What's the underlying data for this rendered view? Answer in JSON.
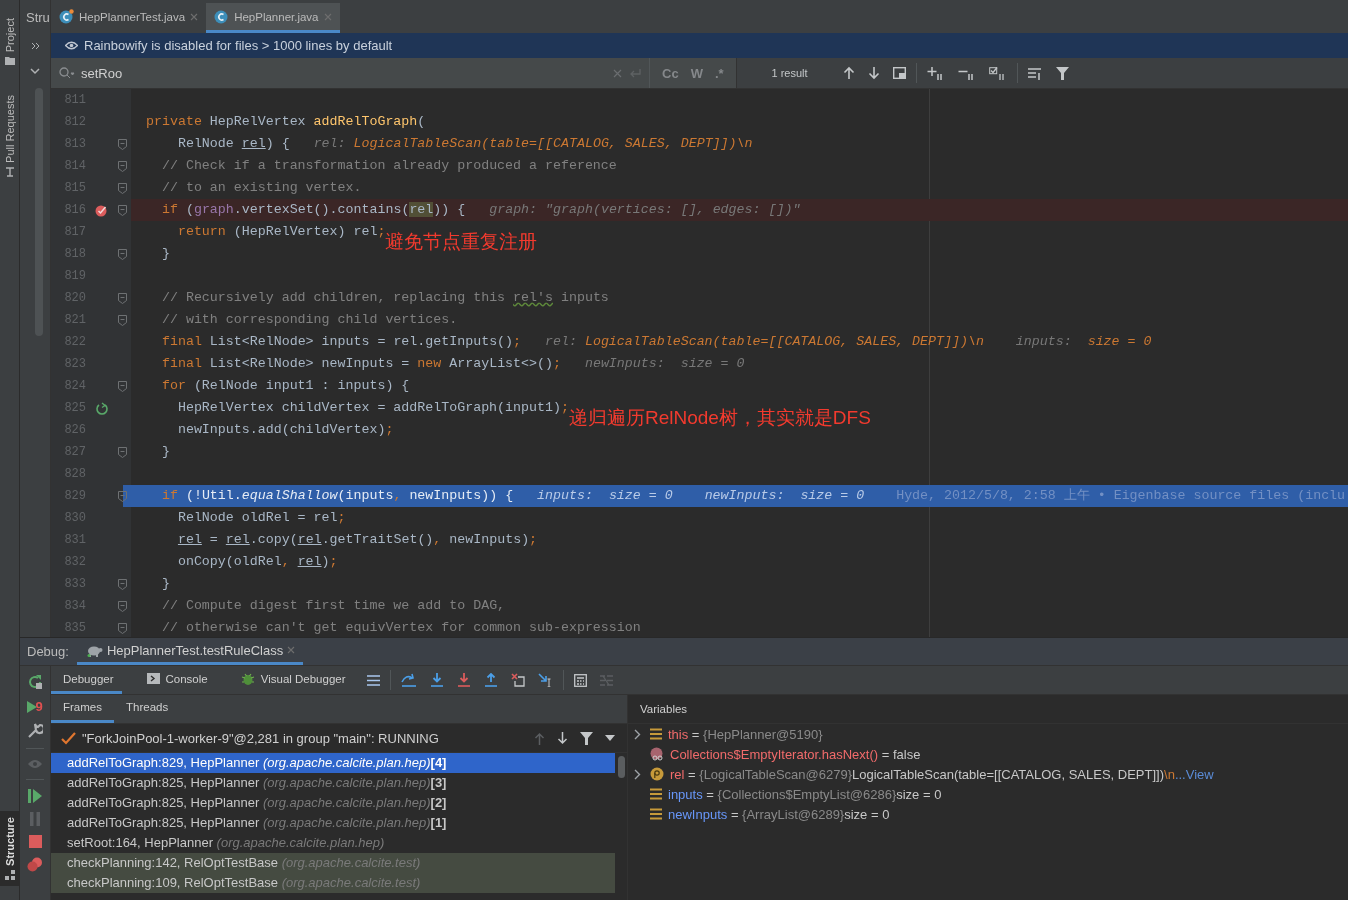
{
  "tool_strip": [
    {
      "label": "Project",
      "selected": false
    },
    {
      "label": "Pull Requests",
      "selected": false
    },
    {
      "label": "Structure",
      "selected": true
    }
  ],
  "structure_panel": {
    "title": "Stru"
  },
  "tabs": [
    {
      "label": "HepPlannerTest.java",
      "selected": false,
      "kind": "test"
    },
    {
      "label": "HepPlanner.java",
      "selected": true,
      "kind": "class"
    }
  ],
  "banner": {
    "text": "Rainbowify is disabled for files > 1000 lines by default"
  },
  "search": {
    "value": "setRoo",
    "toggles": [
      {
        "label": "Cc",
        "enabled": false
      },
      {
        "label": "W",
        "enabled": false
      },
      {
        "label": ".*",
        "enabled": false
      }
    ],
    "result": "1 result"
  },
  "editor": {
    "lines": [
      {
        "number": "811",
        "current": false
      },
      {
        "number": "812",
        "current": false,
        "segments": [
          {
            "kind": "kw",
            "text": "private "
          },
          {
            "kind": "id",
            "text": "HepRelVertex "
          },
          {
            "kind": "fn",
            "text": "addRelToGraph"
          },
          {
            "kind": "id",
            "text": "("
          }
        ]
      },
      {
        "number": "813",
        "current": false,
        "fold": true,
        "segments": [
          {
            "kind": "id",
            "text": "    RelNode "
          },
          {
            "kind": "u",
            "text": "rel"
          },
          {
            "kind": "id",
            "text": ") {"
          },
          {
            "kind": "hl",
            "text": "   rel: "
          },
          {
            "kind": "hv",
            "text": "LogicalTableScan(table=[[CATALOG, SALES, DEPT]])\\n"
          }
        ]
      },
      {
        "number": "814",
        "current": false,
        "fold": true,
        "segments": [
          {
            "kind": "cm",
            "text": "  // Check if a transformation already produced a reference"
          }
        ]
      },
      {
        "number": "815",
        "current": false,
        "fold": true,
        "segments": [
          {
            "kind": "cm",
            "text": "  // to an existing vertex."
          }
        ]
      },
      {
        "number": "816",
        "current": false,
        "marker": {
          "kind": "breakpoint"
        },
        "fold": true,
        "segments": [
          {
            "kind": "kw",
            "text": "  if "
          },
          {
            "kind": "id",
            "text": "("
          },
          {
            "kind": "field",
            "text": "graph"
          },
          {
            "kind": "id",
            "text": ".vertexSet().contains("
          },
          {
            "kind": "sel",
            "text": "rel"
          },
          {
            "kind": "id",
            "text": ")) {"
          },
          {
            "kind": "hl",
            "text": "   graph: \"graph(vertices: [], edges: [])\""
          }
        ]
      },
      {
        "number": "817",
        "current": false,
        "segments": [
          {
            "kind": "kw",
            "text": "    return "
          },
          {
            "kind": "id",
            "text": "(HepRelVertex) rel"
          },
          {
            "kind": "kw",
            "text": ";"
          }
        ],
        "annotation": "避免节点重复注册"
      },
      {
        "number": "818",
        "current": false,
        "fold": true,
        "segments": [
          {
            "kind": "id",
            "text": "  }"
          }
        ]
      },
      {
        "number": "819",
        "current": false
      },
      {
        "number": "820",
        "current": false,
        "fold": true,
        "segments": [
          {
            "kind": "cm",
            "text": "  // Recursively add children, replacing this "
          },
          {
            "kind": "cmw",
            "text": "rel's"
          },
          {
            "kind": "cm",
            "text": " inputs"
          }
        ]
      },
      {
        "number": "821",
        "current": false,
        "fold": true,
        "segments": [
          {
            "kind": "cm",
            "text": "  // with corresponding child vertices."
          }
        ]
      },
      {
        "number": "822",
        "current": false,
        "segments": [
          {
            "kind": "kw",
            "text": "  final "
          },
          {
            "kind": "id",
            "text": "List<RelNode> inputs = rel.getInputs()"
          },
          {
            "kind": "kw",
            "text": ";"
          },
          {
            "kind": "hl",
            "text": "   rel: "
          },
          {
            "kind": "hv",
            "text": "LogicalTableScan(table=[[CATALOG, SALES, DEPT]])\\n"
          },
          {
            "kind": "hl",
            "text": "    inputs:  "
          },
          {
            "kind": "hv",
            "text": "size = 0"
          }
        ]
      },
      {
        "number": "823",
        "current": false,
        "segments": [
          {
            "kind": "kw",
            "text": "  final "
          },
          {
            "kind": "id",
            "text": "List<RelNode> newInputs = "
          },
          {
            "kind": "kw",
            "text": "new "
          },
          {
            "kind": "id",
            "text": "ArrayList<>()"
          },
          {
            "kind": "kw",
            "text": ";"
          },
          {
            "kind": "hl",
            "text": "   newInputs:  size = 0"
          }
        ]
      },
      {
        "number": "824",
        "current": false,
        "fold": true,
        "segments": [
          {
            "kind": "kw",
            "text": "  for "
          },
          {
            "kind": "id",
            "text": "(RelNode input1 : inputs) {"
          }
        ]
      },
      {
        "number": "825",
        "current": false,
        "marker": {
          "kind": "frame"
        },
        "segments": [
          {
            "kind": "id",
            "text": "    HepRelVertex childVertex = addRelToGraph(input1)"
          },
          {
            "kind": "kw",
            "text": ";"
          }
        ],
        "annotation": "递归遍历RelNode树，其实就是DFS"
      },
      {
        "number": "826",
        "current": false,
        "segments": [
          {
            "kind": "id",
            "text": "    newInputs.add(childVertex)"
          },
          {
            "kind": "kw",
            "text": ";"
          }
        ]
      },
      {
        "number": "827",
        "current": false,
        "fold": true,
        "segments": [
          {
            "kind": "id",
            "text": "  }"
          }
        ]
      },
      {
        "number": "828",
        "current": false
      },
      {
        "number": "829",
        "current": true,
        "fold": true,
        "segments": [
          {
            "kind": "kw",
            "text": "  if "
          },
          {
            "kind": "id",
            "text": "(!Util."
          },
          {
            "kind": "it",
            "text": "equalShallow"
          },
          {
            "kind": "id",
            "text": "(inputs"
          },
          {
            "kind": "kw",
            "text": ", "
          },
          {
            "kind": "id",
            "text": "newInputs)) {"
          },
          {
            "kind": "hl",
            "text": "   inputs:  size = 0    newInputs:  size = 0"
          },
          {
            "kind": "blame",
            "text": "    Hyde, 2012/5/8, 2:58 上午 • Eigenbase source files (inclu"
          }
        ]
      },
      {
        "number": "830",
        "current": false,
        "segments": [
          {
            "kind": "id",
            "text": "    RelNode oldRel = rel"
          },
          {
            "kind": "kw",
            "text": ";"
          }
        ]
      },
      {
        "number": "831",
        "current": false,
        "segments": [
          {
            "kind": "u",
            "text": "    rel"
          },
          {
            "kind": "id",
            "text": " = "
          },
          {
            "kind": "u",
            "text": "rel"
          },
          {
            "kind": "id",
            "text": ".copy("
          },
          {
            "kind": "u",
            "text": "rel"
          },
          {
            "kind": "id",
            "text": ".getTraitSet()"
          },
          {
            "kind": "kw",
            "text": ", "
          },
          {
            "kind": "id",
            "text": "newInputs)"
          },
          {
            "kind": "kw",
            "text": ";"
          }
        ]
      },
      {
        "number": "832",
        "current": false,
        "segments": [
          {
            "kind": "id",
            "text": "    onCopy(oldRel"
          },
          {
            "kind": "kw",
            "text": ", "
          },
          {
            "kind": "u",
            "text": "rel"
          },
          {
            "kind": "id",
            "text": ")"
          },
          {
            "kind": "kw",
            "text": ";"
          }
        ]
      },
      {
        "number": "833",
        "current": false,
        "fold": true,
        "segments": [
          {
            "kind": "id",
            "text": "  }"
          }
        ]
      },
      {
        "number": "834",
        "current": false,
        "fold": true,
        "segments": [
          {
            "kind": "cm",
            "text": "  // Compute digest first time we add to DAG,"
          }
        ]
      },
      {
        "number": "835",
        "current": false,
        "fold": true,
        "segments": [
          {
            "kind": "cm",
            "text": "  // otherwise can't get equivVertex for common sub-expression"
          }
        ]
      }
    ]
  },
  "debug": {
    "label": "Debug:",
    "session": "HepPlannerTest.testRuleClass",
    "resume_badge": "9",
    "tabs": [
      {
        "label": "Debugger",
        "selected": true,
        "kind": "plain"
      },
      {
        "label": "Console",
        "selected": false,
        "kind": "console"
      },
      {
        "label": "Visual Debugger",
        "selected": false,
        "kind": "bug"
      }
    ],
    "panel_tabs": [
      {
        "label": "Frames",
        "selected": true
      },
      {
        "label": "Threads",
        "selected": false
      }
    ],
    "thread": "\"ForkJoinPool-1-worker-9\"@2,281 in group \"main\": RUNNING",
    "frames": [
      {
        "method": "addRelToGraph:829, HepPlanner",
        "package": "(org.apache.calcite.plan.hep)",
        "depth": "[4]",
        "selected": true,
        "library": false
      },
      {
        "method": "addRelToGraph:825, HepPlanner",
        "package": "(org.apache.calcite.plan.hep)",
        "depth": "[3]",
        "selected": false,
        "library": false
      },
      {
        "method": "addRelToGraph:825, HepPlanner",
        "package": "(org.apache.calcite.plan.hep)",
        "depth": "[2]",
        "selected": false,
        "library": false
      },
      {
        "method": "addRelToGraph:825, HepPlanner",
        "package": "(org.apache.calcite.plan.hep)",
        "depth": "[1]",
        "selected": false,
        "library": false
      },
      {
        "method": "setRoot:164, HepPlanner",
        "package": "(org.apache.calcite.plan.hep)",
        "selected": false,
        "library": false
      },
      {
        "method": "checkPlanning:142, RelOptTestBase",
        "package": "(org.apache.calcite.test)",
        "selected": false,
        "library": true
      },
      {
        "method": "checkPlanning:109, RelOptTestBase",
        "package": "(org.apache.calcite.test)",
        "selected": false,
        "library": true
      }
    ]
  },
  "variables": {
    "title": "Variables",
    "items": [
      {
        "kind": "field",
        "expandable": true,
        "name": "this",
        "color": "#f26b6b",
        "op": "=",
        "ref": "{HepPlanner@5190}"
      },
      {
        "kind": "method",
        "expandable": false,
        "name": "Collections$EmptyIterator.hasNext()",
        "color": "#f26b6b",
        "op": "=",
        "value": "false"
      },
      {
        "kind": "param",
        "expandable": true,
        "name": "rel",
        "color": "#f26b6b",
        "op": "=",
        "ref": "{LogicalTableScan@6279}",
        "value": "LogicalTableScan(table=[[CATALOG, SALES, DEPT]])",
        "escape": "\\n",
        "more": "...",
        "link": "View"
      },
      {
        "kind": "field",
        "expandable": false,
        "name": "inputs",
        "color": "#6897fa",
        "op": "=",
        "ref": "{Collections$EmptyList@6286}",
        "value": "size = 0"
      },
      {
        "kind": "field",
        "expandable": false,
        "name": "newInputs",
        "color": "#6897fa",
        "op": "=",
        "ref": "{ArrayList@6289}",
        "value": "size = 0"
      }
    ]
  }
}
